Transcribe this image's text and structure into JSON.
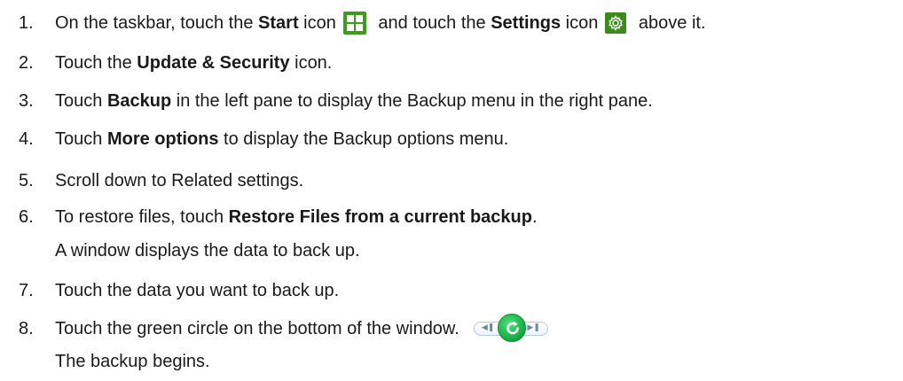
{
  "steps": [
    {
      "num": "1.",
      "pre": "On the taskbar, touch the ",
      "b1": "Start",
      "mid1": " icon",
      "mid2": " and touch the ",
      "b2": "Settings",
      "mid3": " icon",
      "post": " above it."
    },
    {
      "num": "2.",
      "pre": "Touch the ",
      "b1": "Update & Security",
      "post": " icon."
    },
    {
      "num": "3.",
      "pre": "Touch ",
      "b1": "Backup",
      "post": " in the left pane to display the Backup menu in the right pane."
    },
    {
      "num": "4.",
      "pre": "Touch ",
      "b1": "More options",
      "post": " to display the Backup options menu."
    },
    {
      "num": "5.",
      "text": "Scroll down to Related settings."
    },
    {
      "num": "6.",
      "pre": "To restore files, touch ",
      "b1": "Restore Files from a current backup",
      "post": ".",
      "sub": "A window displays the data to back up."
    },
    {
      "num": "7.",
      "text": "Touch the data you want to back up."
    },
    {
      "num": "8.",
      "text": "Touch the green circle on the bottom of the window.",
      "sub": "The backup begins."
    }
  ],
  "icons": {
    "start": "windows-start-icon",
    "settings": "gear-icon",
    "player_prev": "previous-icon",
    "player_restore": "refresh-icon",
    "player_next": "next-icon"
  },
  "colors": {
    "start_icon": "#3f9a1e",
    "settings_icon": "#3a8a1c",
    "green_circle": "#13a940"
  }
}
